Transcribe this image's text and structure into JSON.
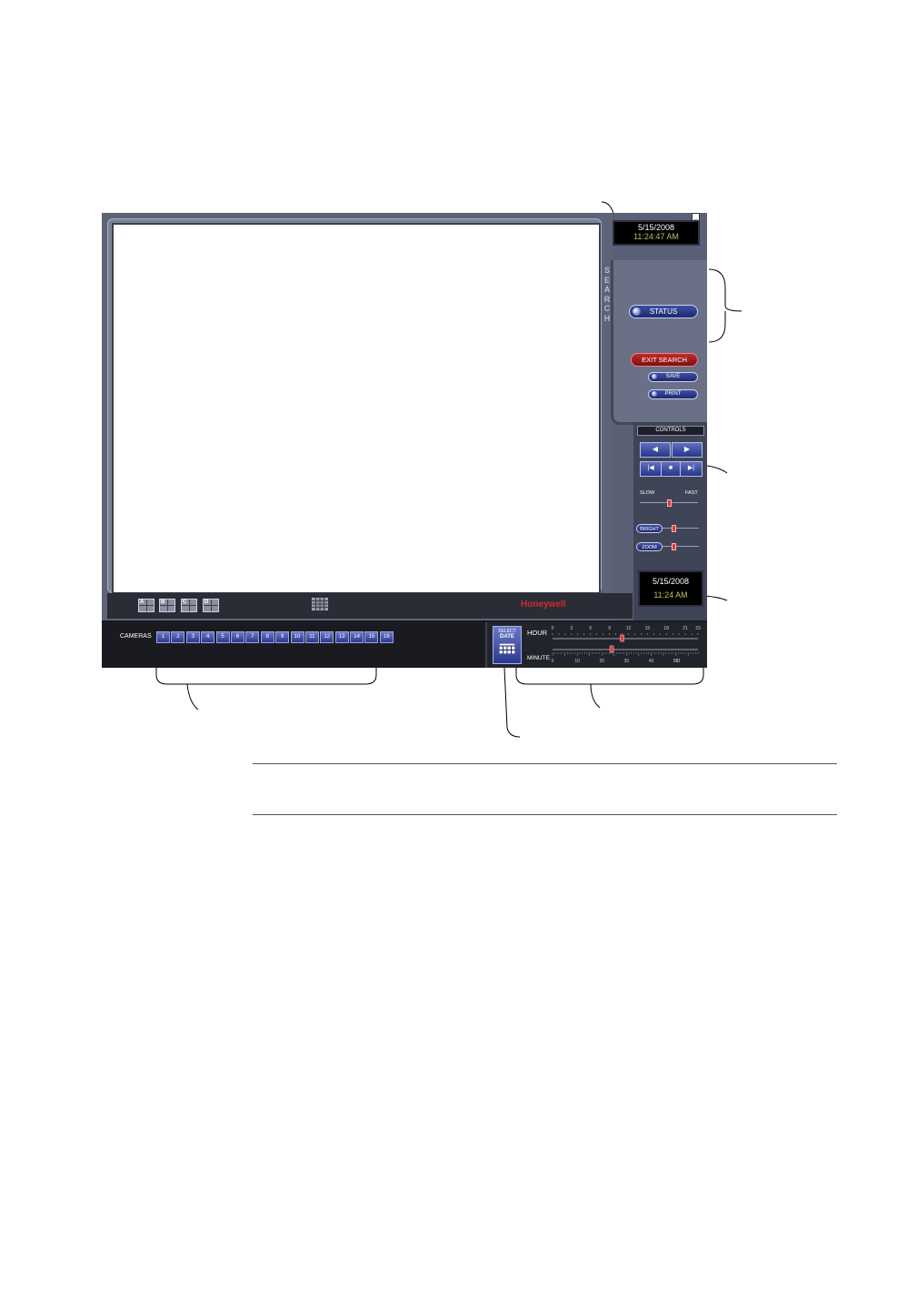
{
  "window": {
    "minimize_glyph": "_",
    "close_glyph": "x"
  },
  "top_clock": {
    "date": "5/15/2008",
    "time": "11:24:47 AM"
  },
  "search_tab": {
    "letters": [
      "S",
      "E",
      "A",
      "R",
      "C",
      "H"
    ]
  },
  "buttons": {
    "status": "STATUS",
    "exit_search": "EXIT SEARCH",
    "save": "SAVE",
    "print": "PRINT"
  },
  "controls": {
    "header": "CONTROLS",
    "rewind": "◀",
    "play": "▶",
    "skip_back": "|◀",
    "stop": "■",
    "skip_forward": "▶|",
    "slow_label": "SLOW",
    "fast_label": "FAST",
    "speed_level": 0.5,
    "bright_label": "BRIGHT",
    "bright_level": 0.3,
    "zoom_label": "ZOOM",
    "zoom_level": 0.3
  },
  "playback_clock": {
    "date": "5/15/2008",
    "time": "11:24 AM"
  },
  "layouts": [
    "A",
    "B",
    "C",
    "D"
  ],
  "brand": "Honeywell",
  "cameras": {
    "label": "CAMERAS",
    "numbers": [
      "1",
      "2",
      "3",
      "4",
      "5",
      "6",
      "7",
      "8",
      "9",
      "10",
      "11",
      "12",
      "13",
      "14",
      "15",
      "16"
    ]
  },
  "select_date": {
    "line1": "SELECT",
    "line2": "DATE"
  },
  "timeline": {
    "hour_label": "HOUR",
    "hour_ticks": [
      "0",
      "3",
      "6",
      "9",
      "12",
      "15",
      "18",
      "21",
      "23"
    ],
    "hour_value": 11,
    "minute_label": "MINUTE",
    "minute_ticks": [
      "0",
      "10",
      "20",
      "30",
      "40",
      "50",
      "51"
    ],
    "minute_value": 24
  },
  "colors": {
    "panel": "#5d6478",
    "status_button": "#2c3a8c",
    "exit_button": "#a01c1c",
    "brand_red": "#d42a2a",
    "clock_green": "#b9c25a"
  }
}
